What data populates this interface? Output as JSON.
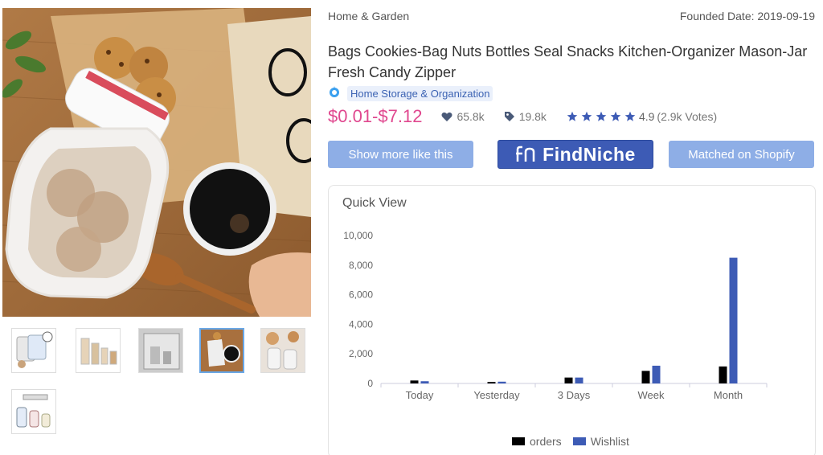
{
  "gallery": {
    "main_image_name": "mason-jar-zipper-bag-photo",
    "thumbnails": [
      "thumb-1",
      "thumb-2",
      "thumb-3",
      "thumb-4",
      "thumb-5",
      "thumb-6"
    ],
    "active_thumbnail": 3
  },
  "product": {
    "category_path": "Home & Garden",
    "founded_date": "Founded Date: 2019-09-19",
    "title": "Bags Cookies-Bag Nuts Bottles Seal Snacks Kitchen-Organizer Mason-Jar Fresh Candy Zipper",
    "category_tag": "Home Storage & Organization",
    "price": "$0.01-$7.12",
    "likes": "65.8k",
    "tags_count": "19.8k",
    "rating": "4.9",
    "votes": "(2.9k Votes)",
    "stars": 5,
    "star_color": "#3d5bb5",
    "price_color": "#e0488f"
  },
  "buttons": {
    "show_more": "Show more like this",
    "findniche": "FindNiche",
    "matched_shopify": "Matched on Shopify"
  },
  "quick_view": {
    "title": "Quick View"
  },
  "chart_data": {
    "type": "bar",
    "categories": [
      "Today",
      "Yesterday",
      "3 Days",
      "Week",
      "Month"
    ],
    "series": [
      {
        "name": "orders",
        "color": "#000000",
        "values": [
          200,
          100,
          400,
          850,
          1150
        ]
      },
      {
        "name": "Wishlist",
        "color": "#3d5bb5",
        "values": [
          150,
          120,
          400,
          1200,
          8500
        ]
      }
    ],
    "ylim": [
      0,
      10000
    ],
    "yticks": [
      0,
      2000,
      4000,
      6000,
      8000,
      10000
    ],
    "ytick_labels": [
      "0",
      "2,000",
      "4,000",
      "6,000",
      "8,000",
      "10,000"
    ],
    "legend_position": "bottom",
    "grid": false
  }
}
